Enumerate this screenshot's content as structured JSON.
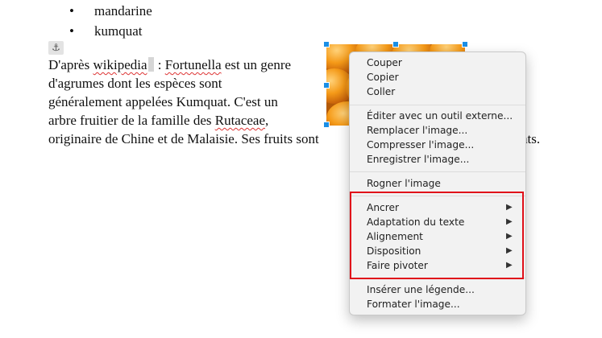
{
  "document": {
    "bullets": [
      "mandarine",
      "kumquat"
    ],
    "anchor_glyph": "⚓",
    "paragraph": {
      "line1_a": "D'après ",
      "line1_b": "wikipedia",
      "line1_c": " : ",
      "line1_d": "Fortunella",
      "line1_e": " est un genre",
      "line2": "d'agrumes dont les espèces sont",
      "line3": "généralement appelées Kumquat. C'est un",
      "line4_a": "arbre fruitier de la famille des ",
      "line4_b": "Rutaceae",
      "line4_c": ",",
      "line5": "originaire de Chine et de Malaisie. Ses fruits sont",
      "line5_tail": "quats."
    }
  },
  "image": {
    "icon": "kumquat-photo"
  },
  "context_menu": {
    "group1": [
      "Couper",
      "Copier",
      "Coller"
    ],
    "group2": [
      "Éditer avec un outil externe...",
      "Remplacer l'image...",
      "Compresser l'image...",
      "Enregistrer l'image..."
    ],
    "group3": [
      "Rogner l'image"
    ],
    "group4": [
      "Ancrer",
      "Adaptation du texte",
      "Alignement",
      "Disposition",
      "Faire pivoter"
    ],
    "group5": [
      "Insérer une légende...",
      "Formater l'image..."
    ],
    "submenu_arrow": "▶"
  },
  "colors": {
    "highlight": "#e0101a",
    "selection_handle": "#1b8fe6"
  }
}
